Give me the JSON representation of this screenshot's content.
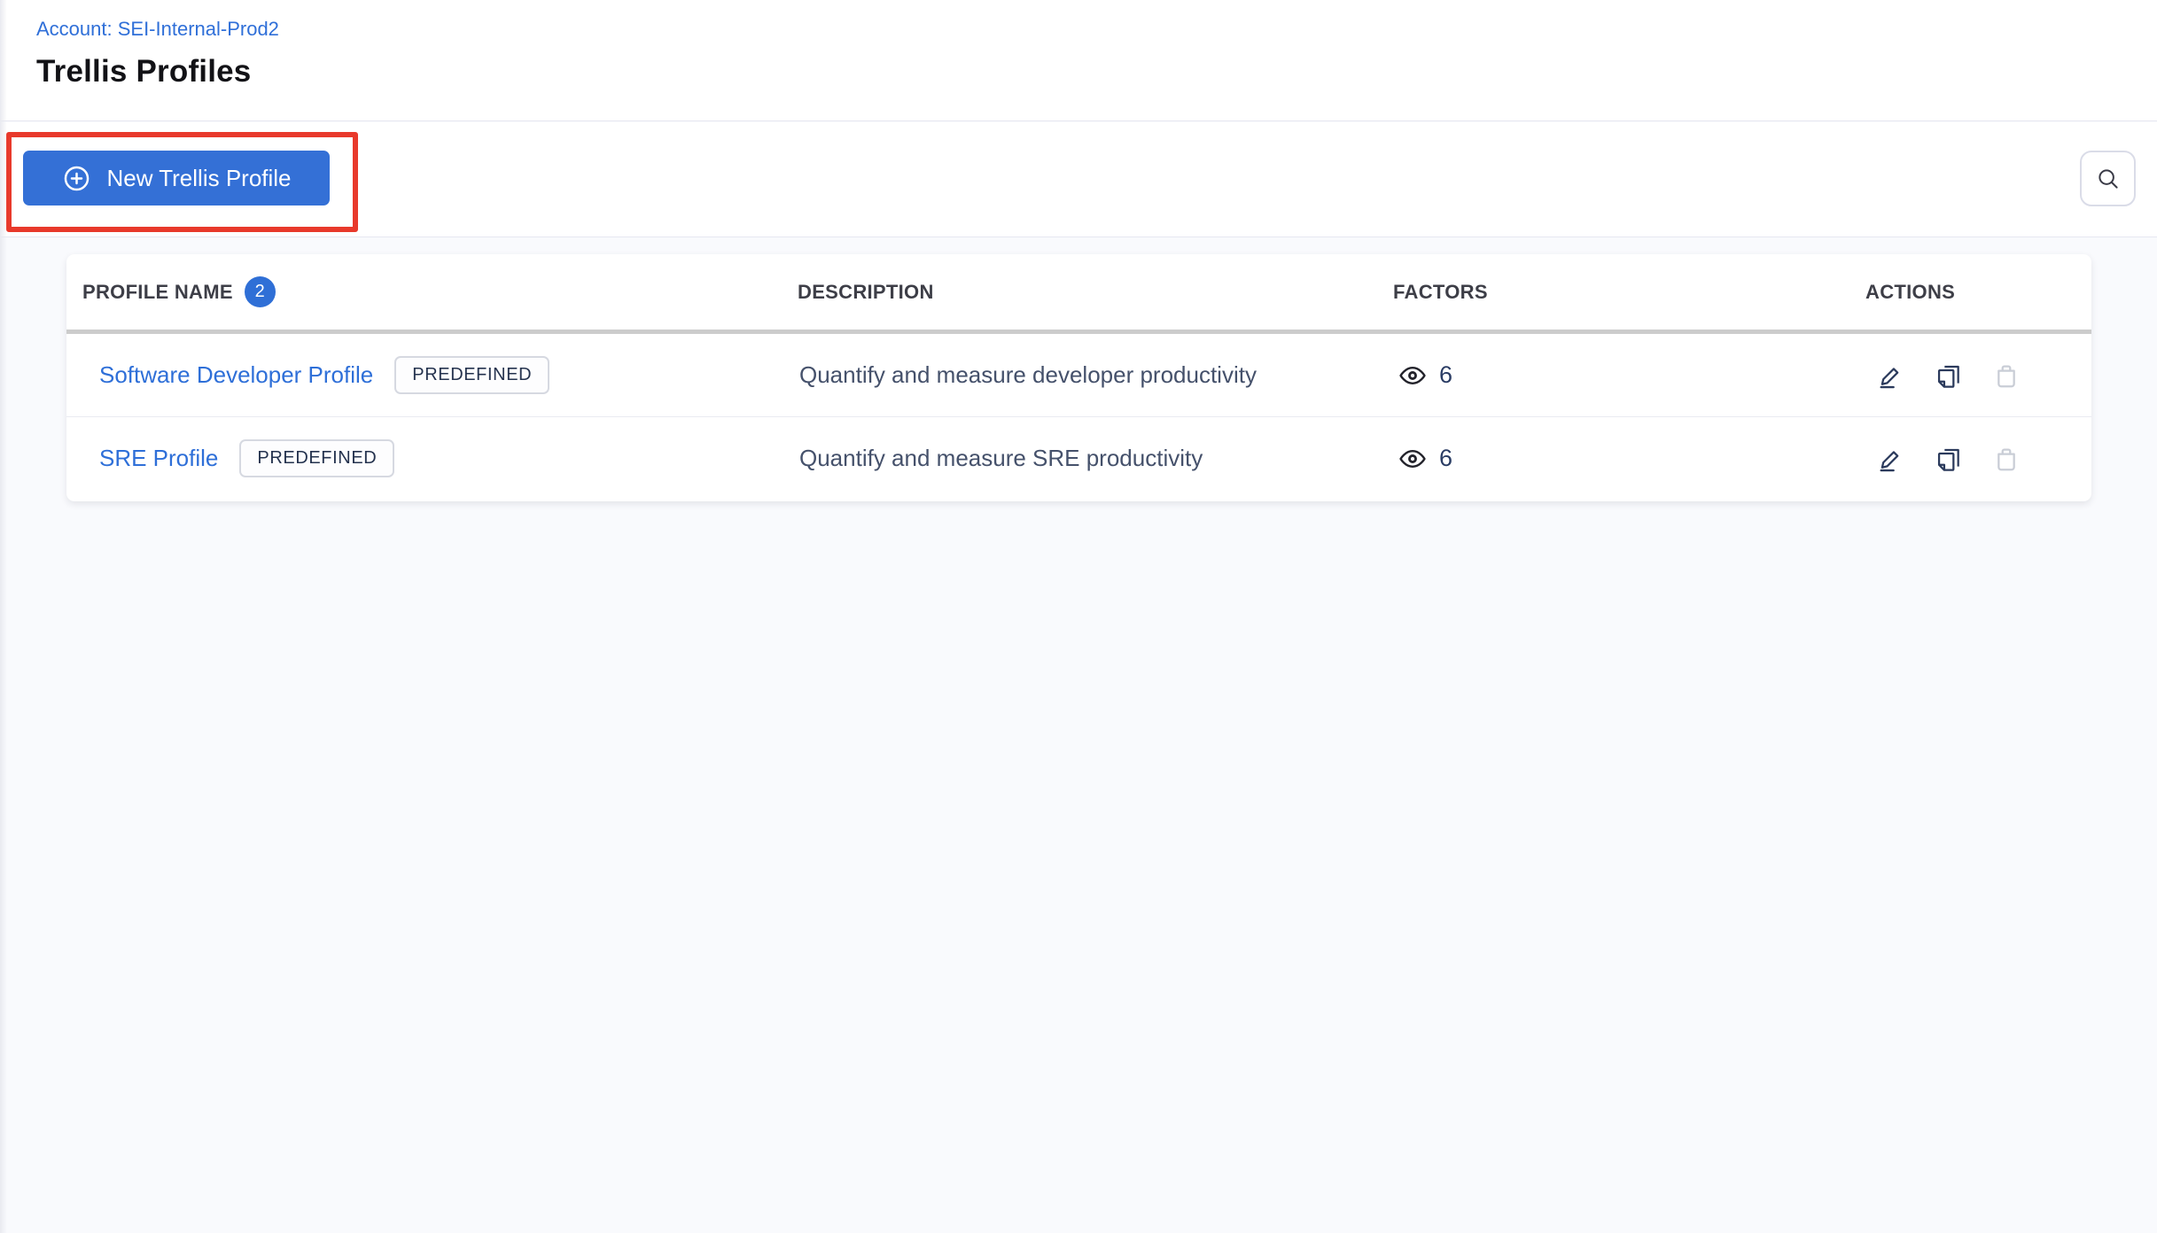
{
  "header": {
    "account_link": "Account: SEI-Internal-Prod2",
    "title": "Trellis Profiles"
  },
  "toolbar": {
    "new_profile_button_label": "New Trellis Profile"
  },
  "table": {
    "columns": {
      "profile_name": "PROFILE NAME",
      "count_badge": "2",
      "description": "DESCRIPTION",
      "factors": "FACTORS",
      "actions": "ACTIONS"
    },
    "rows": [
      {
        "name": "Software Developer Profile",
        "tag": "PREDEFINED",
        "description": "Quantify and measure developer productivity",
        "factors_count": "6"
      },
      {
        "name": "SRE Profile",
        "tag": "PREDEFINED",
        "description": "Quantify and measure SRE productivity",
        "factors_count": "6"
      }
    ]
  },
  "icons": {
    "button_icon": "plus-circle-icon",
    "search": "search-icon",
    "factors": "eye-icon",
    "row_actions": [
      "edit-pencil-icon",
      "copy-icon",
      "trash-icon"
    ]
  },
  "colors": {
    "primary_button_blue": "#3470d6",
    "link_blue": "#2e6fd8",
    "count_badge_blue": "#2f6fd6",
    "annotation_red": "#e8392b",
    "navy_text": "#24324e",
    "disabled_icon_grey": "#c9cdd6",
    "page_background": "#f9fafd",
    "header_underline_grey": "#cccccc"
  }
}
